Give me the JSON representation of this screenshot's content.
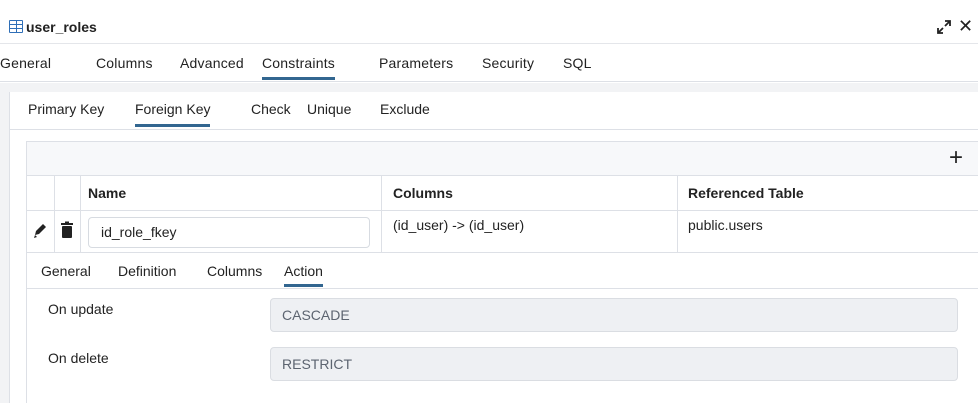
{
  "dialog": {
    "title": "user_roles",
    "expand_icon": "expand-icon",
    "close_icon": "close-icon",
    "close_glyph": "✕"
  },
  "main_tabs": [
    "General",
    "Columns",
    "Advanced",
    "Constraints",
    "Parameters",
    "Security",
    "SQL"
  ],
  "main_tabs_active": "Constraints",
  "constraint_tabs": [
    "Primary Key",
    "Foreign Key",
    "Check",
    "Unique",
    "Exclude"
  ],
  "constraint_tabs_active": "Foreign Key",
  "grid": {
    "add_label": "+",
    "columns": [
      "Name",
      "Columns",
      "Referenced Table"
    ],
    "rows": [
      {
        "name": "id_role_fkey",
        "columns": "(id_user) -> (id_user)",
        "referenced_table": "public.users"
      }
    ]
  },
  "detail_tabs": [
    "General",
    "Definition",
    "Columns",
    "Action"
  ],
  "detail_tabs_active": "Action",
  "action": {
    "on_update_label": "On update",
    "on_update_value": "CASCADE",
    "on_delete_label": "On delete",
    "on_delete_value": "RESTRICT"
  },
  "colors": {
    "accent": "#326690",
    "table_icon": "#2f6fb7",
    "panel_bg": "#f2f3f5",
    "readonly_field_bg": "#eef0f3"
  }
}
